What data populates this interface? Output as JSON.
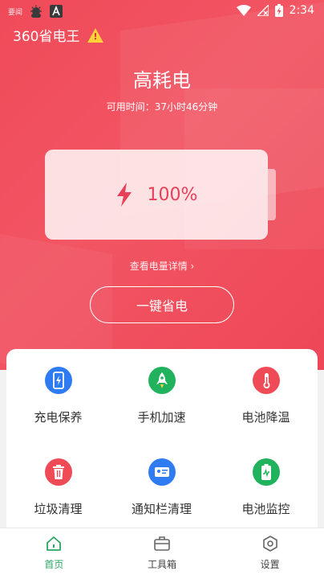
{
  "statusbar": {
    "carrier_tiny": "要闻",
    "time": "2:34"
  },
  "app": {
    "title": "360省电王",
    "warning_glyph": "!"
  },
  "battery": {
    "status_title": "高耗电",
    "remaining_label": "可用时间：37小时46分钟",
    "percent_text": "100%",
    "level": 1.0,
    "details_link": "查看电量详情 ›",
    "one_click_save": "一键省电"
  },
  "features": [
    {
      "label": "充电保养",
      "icon": "phone-charge-icon",
      "color": "#2f7bf2"
    },
    {
      "label": "手机加速",
      "icon": "rocket-icon",
      "color": "#20b25c"
    },
    {
      "label": "电池降温",
      "icon": "thermometer-icon",
      "color": "#ee4b57"
    },
    {
      "label": "垃圾清理",
      "icon": "trash-icon",
      "color": "#ee4b57"
    },
    {
      "label": "通知栏清理",
      "icon": "notification-card-icon",
      "color": "#2f7bf2"
    },
    {
      "label": "电池监控",
      "icon": "battery-monitor-icon",
      "color": "#20b25c"
    }
  ],
  "tabs": [
    {
      "label": "首页",
      "icon": "home-icon",
      "active": true
    },
    {
      "label": "工具箱",
      "icon": "toolbox-icon",
      "active": false
    },
    {
      "label": "设置",
      "icon": "settings-icon",
      "active": false
    }
  ],
  "colors": {
    "accent_red": "#f04a59",
    "accent_green": "#2ba661",
    "accent_blue": "#2f7bf2"
  }
}
